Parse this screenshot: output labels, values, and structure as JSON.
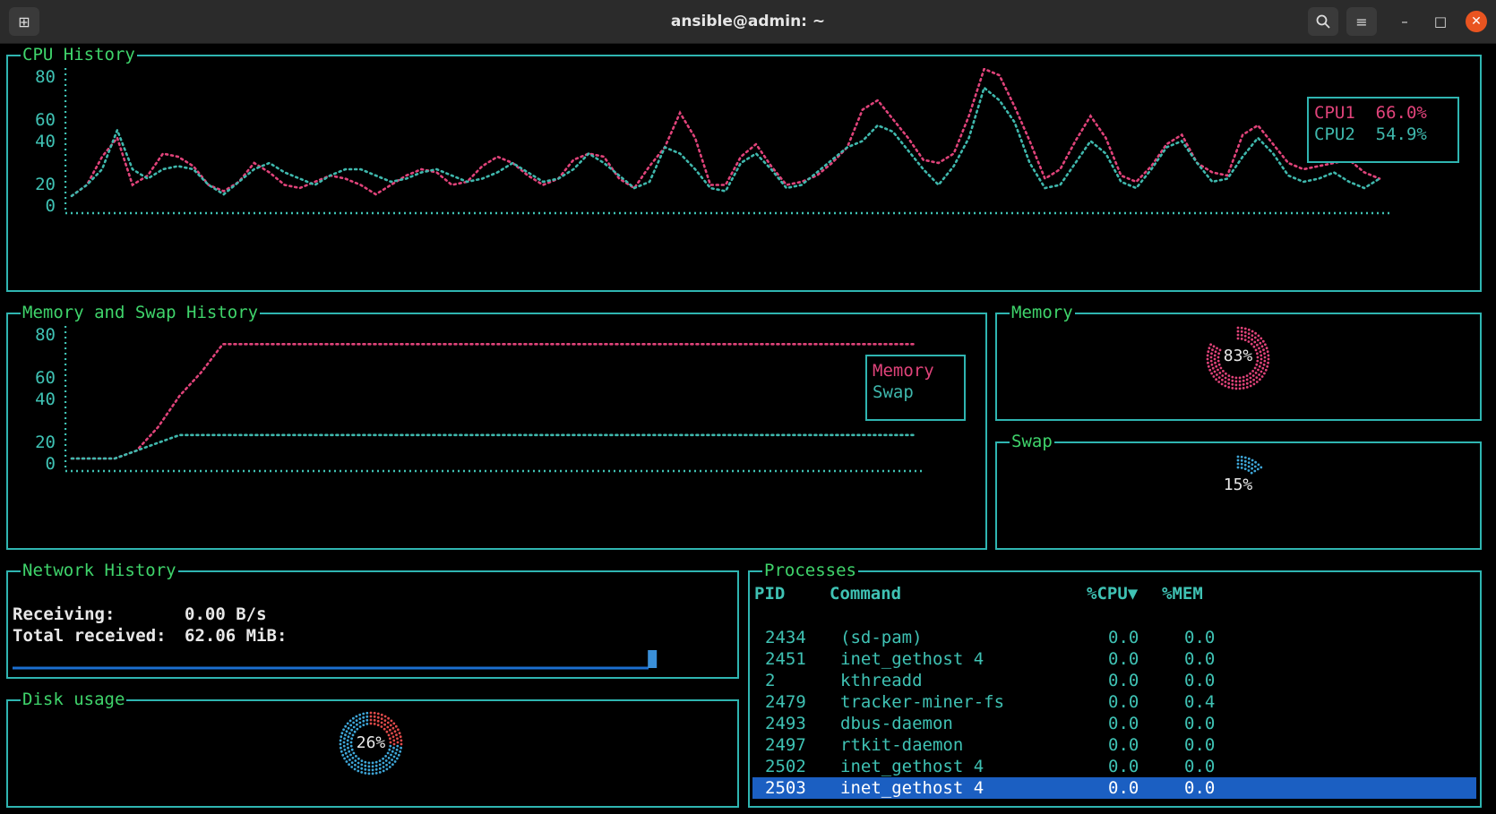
{
  "window": {
    "title": "ansible@admin: ~"
  },
  "titlebar_icons": {
    "new_tab": "new-tab-icon",
    "search": "search-icon",
    "menu": "hamburger-menu-icon",
    "minimize": "minimize-icon",
    "maximize": "maximize-icon",
    "close": "close-icon"
  },
  "cpu_panel": {
    "title": "CPU History",
    "yticks": [
      "80",
      "60",
      "40",
      "20",
      "0"
    ],
    "legend": [
      {
        "name": "CPU1",
        "value": "66.0%",
        "color": "#e0437a"
      },
      {
        "name": "CPU2",
        "value": "54.9%",
        "color": "#3fb8ad"
      }
    ]
  },
  "mem_history_panel": {
    "title": "Memory and Swap History",
    "yticks": [
      "80",
      "60",
      "40",
      "20",
      "0"
    ],
    "legend": [
      {
        "name": "Memory",
        "color": "#e0437a"
      },
      {
        "name": "Swap",
        "color": "#3fb8ad"
      }
    ]
  },
  "memory_panel": {
    "title": "Memory",
    "percent_label": "83%",
    "value": 0.83,
    "color": "#e0437a"
  },
  "swap_panel": {
    "title": "Swap",
    "percent_label": "15%",
    "value": 0.15,
    "color": "#3ea6d8"
  },
  "network_panel": {
    "title": "Network History",
    "receiving_label": "Receiving:",
    "receiving_value": "0.00 B/s",
    "total_label": "Total received:",
    "total_value": "62.06 MiB:"
  },
  "disk_panel": {
    "title": "Disk usage",
    "percent_label": "26%",
    "value": 0.26,
    "color": "#3ea6d8",
    "used_color": "#e04a4a"
  },
  "processes_panel": {
    "title": "Processes",
    "headers": {
      "pid": "PID",
      "command": "Command",
      "cpu": "%CPU▼",
      "mem": "%MEM"
    },
    "rows": [
      {
        "pid": "2434",
        "command": "(sd-pam)",
        "cpu": "0.0",
        "mem": "0.0"
      },
      {
        "pid": "2451",
        "command": "inet_gethost 4",
        "cpu": "0.0",
        "mem": "0.0"
      },
      {
        "pid": "2",
        "command": "kthreadd",
        "cpu": "0.0",
        "mem": "0.0"
      },
      {
        "pid": "2479",
        "command": "tracker-miner-fs",
        "cpu": "0.0",
        "mem": "0.4"
      },
      {
        "pid": "2493",
        "command": "dbus-daemon",
        "cpu": "0.0",
        "mem": "0.0"
      },
      {
        "pid": "2497",
        "command": "rtkit-daemon",
        "cpu": "0.0",
        "mem": "0.0"
      },
      {
        "pid": "2502",
        "command": "inet_gethost 4",
        "cpu": "0.0",
        "mem": "0.0"
      },
      {
        "pid": "2503",
        "command": "inet_gethost 4",
        "cpu": "0.0",
        "mem": "0.0",
        "selected": true
      }
    ]
  },
  "chart_data": [
    {
      "type": "line",
      "title": "CPU History",
      "ylim": [
        0,
        80
      ],
      "series": [
        {
          "name": "CPU1",
          "values": [
            3,
            10,
            28,
            40,
            10,
            16,
            30,
            28,
            22,
            10,
            6,
            12,
            24,
            18,
            10,
            8,
            12,
            16,
            14,
            10,
            4,
            10,
            16,
            20,
            18,
            10,
            12,
            22,
            28,
            24,
            16,
            10,
            14,
            26,
            30,
            28,
            14,
            8,
            22,
            34,
            56,
            40,
            10,
            10,
            28,
            36,
            22,
            10,
            12,
            16,
            24,
            34,
            58,
            64,
            52,
            40,
            26,
            24,
            30,
            54,
            84,
            80,
            60,
            38,
            14,
            20,
            38,
            54,
            40,
            16,
            12,
            22,
            36,
            42,
            24,
            18,
            16,
            42,
            48,
            36,
            24,
            20,
            22,
            24,
            26,
            18,
            14
          ]
        },
        {
          "name": "CPU2",
          "values": [
            3,
            10,
            20,
            45,
            20,
            14,
            20,
            22,
            20,
            10,
            4,
            12,
            20,
            24,
            18,
            14,
            10,
            16,
            20,
            20,
            16,
            12,
            14,
            18,
            20,
            16,
            12,
            14,
            18,
            24,
            18,
            12,
            14,
            20,
            30,
            24,
            16,
            8,
            12,
            34,
            30,
            20,
            8,
            6,
            24,
            30,
            20,
            8,
            10,
            18,
            26,
            34,
            38,
            48,
            44,
            32,
            20,
            10,
            22,
            40,
            72,
            64,
            50,
            24,
            8,
            10,
            24,
            38,
            30,
            12,
            8,
            20,
            34,
            38,
            24,
            12,
            14,
            28,
            40,
            30,
            16,
            12,
            14,
            18,
            12,
            8,
            14
          ]
        }
      ]
    },
    {
      "type": "line",
      "title": "Memory and Swap History",
      "ylim": [
        0,
        80
      ],
      "series": [
        {
          "name": "Memory",
          "values": [
            0,
            0,
            0,
            5,
            20,
            40,
            55,
            73,
            73,
            73,
            73,
            73,
            73,
            73,
            73,
            73,
            73,
            73,
            73,
            73,
            73,
            73,
            73,
            73,
            73,
            73,
            73,
            73,
            73,
            73,
            73,
            73,
            73,
            73,
            73,
            73,
            73,
            73,
            73,
            73
          ]
        },
        {
          "name": "Swap",
          "values": [
            0,
            0,
            0,
            5,
            10,
            15,
            15,
            15,
            15,
            15,
            15,
            15,
            15,
            15,
            15,
            15,
            15,
            15,
            15,
            15,
            15,
            15,
            15,
            15,
            15,
            15,
            15,
            15,
            15,
            15,
            15,
            15,
            15,
            15,
            15,
            15,
            15,
            15,
            15,
            15
          ]
        }
      ]
    },
    {
      "type": "bar",
      "title": "Network History",
      "values": [
        0,
        0,
        0,
        0,
        0,
        0,
        0,
        0,
        0,
        0,
        0,
        0,
        0,
        0,
        0,
        0,
        0,
        0,
        0,
        0,
        0,
        0,
        0,
        0,
        0,
        0,
        0,
        0,
        0,
        0,
        0,
        0,
        0,
        0,
        0,
        0,
        0,
        0,
        0,
        0,
        0,
        0,
        0,
        0,
        0,
        0,
        0,
        0,
        0,
        0,
        0,
        0,
        0,
        0,
        0,
        0,
        0,
        0,
        0,
        0,
        0,
        0,
        0,
        0,
        0,
        0,
        0,
        0,
        0,
        1,
        0,
        0
      ]
    }
  ]
}
